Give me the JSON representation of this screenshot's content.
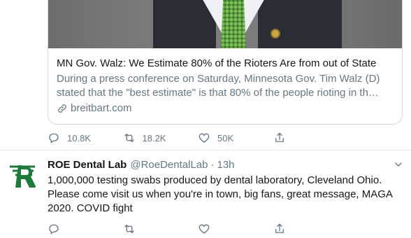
{
  "card": {
    "title": "MN Gov. Walz: We Estimate 80% of the Rioters Are from out of State",
    "description": "During a press conference on Saturday, Minnesota Gov. Tim Walz (D) stated that the \"best estimate\" is that 80% of the people rioting in th…",
    "link": "breitbart.com"
  },
  "tweet1_actions": {
    "replies": "10.8K",
    "retweets": "18.2K",
    "likes": "50K"
  },
  "tweet2": {
    "name": "ROE Dental Lab",
    "handle": "@RoeDentalLab",
    "separator": "·",
    "time": "13h",
    "text": "1,000,000 testing swabs produced by dental laboratory, Cleveland Ohio. Please come visit us when you're in town, big fans, great message, MAGA 2020. COVID fight"
  },
  "colors": {
    "text_primary": "#14171a",
    "text_secondary": "#657786",
    "border": "#ccd6dd",
    "avatar_green": "#1e7a3a"
  },
  "icons": [
    "reply-icon",
    "retweet-icon",
    "like-icon",
    "share-icon",
    "link-icon",
    "chevron-down-icon"
  ]
}
